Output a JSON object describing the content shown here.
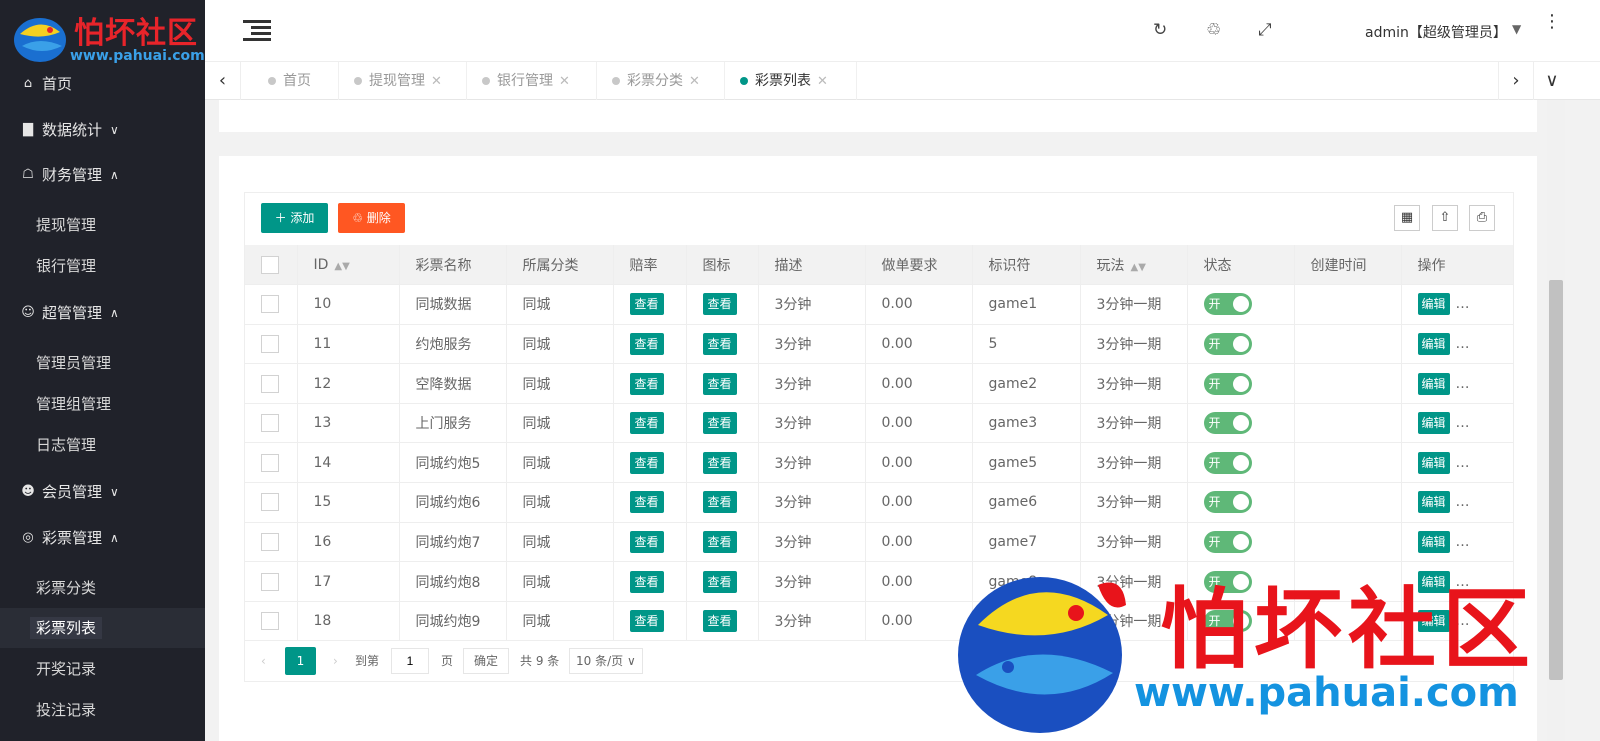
{
  "logo": {
    "text": "怕坏社区",
    "url": "www.pahuai.com"
  },
  "sidebar": {
    "home": "首页",
    "stats": "数据统计",
    "finance": "财务管理",
    "withdraw": "提现管理",
    "bank": "银行管理",
    "super": "超管管理",
    "admin_mgr": "管理员管理",
    "group_mgr": "管理组管理",
    "log_mgr": "日志管理",
    "member": "会员管理",
    "lottery": "彩票管理",
    "lottery_cat": "彩票分类",
    "lottery_list": "彩票列表",
    "draw_record": "开奖记录",
    "bet_record": "投注记录"
  },
  "header": {
    "user": "admin【超级管理员】"
  },
  "tabs": [
    {
      "label": "首页",
      "closable": false
    },
    {
      "label": "提现管理",
      "closable": true
    },
    {
      "label": "银行管理",
      "closable": true
    },
    {
      "label": "彩票分类",
      "closable": true
    },
    {
      "label": "彩票列表",
      "closable": true,
      "active": true
    }
  ],
  "toolbar": {
    "add": "添加",
    "delete": "删除"
  },
  "table": {
    "columns": [
      "ID",
      "彩票名称",
      "所属分类",
      "赔率",
      "图标",
      "描述",
      "做单要求",
      "标识符",
      "玩法",
      "状态",
      "创建时间",
      "操作"
    ],
    "view_label": "查看",
    "edit_label": "编辑",
    "switch_label": "开",
    "more": "…",
    "rows": [
      {
        "id": "10",
        "name": "同城数据",
        "cat": "同城",
        "desc": "3分钟",
        "req": "0.00",
        "code": "game1",
        "play": "3分钟一期"
      },
      {
        "id": "11",
        "name": "约炮服务",
        "cat": "同城",
        "desc": "3分钟",
        "req": "0.00",
        "code": "5",
        "play": "3分钟一期"
      },
      {
        "id": "12",
        "name": "空降数据",
        "cat": "同城",
        "desc": "3分钟",
        "req": "0.00",
        "code": "game2",
        "play": "3分钟一期"
      },
      {
        "id": "13",
        "name": "上门服务",
        "cat": "同城",
        "desc": "3分钟",
        "req": "0.00",
        "code": "game3",
        "play": "3分钟一期"
      },
      {
        "id": "14",
        "name": "同城约炮5",
        "cat": "同城",
        "desc": "3分钟",
        "req": "0.00",
        "code": "game5",
        "play": "3分钟一期"
      },
      {
        "id": "15",
        "name": "同城约炮6",
        "cat": "同城",
        "desc": "3分钟",
        "req": "0.00",
        "code": "game6",
        "play": "3分钟一期"
      },
      {
        "id": "16",
        "name": "同城约炮7",
        "cat": "同城",
        "desc": "3分钟",
        "req": "0.00",
        "code": "game7",
        "play": "3分钟一期"
      },
      {
        "id": "17",
        "name": "同城约炮8",
        "cat": "同城",
        "desc": "3分钟",
        "req": "0.00",
        "code": "game8",
        "play": "3分钟一期"
      },
      {
        "id": "18",
        "name": "同城约炮9",
        "cat": "同城",
        "desc": "3分钟",
        "req": "0.00",
        "code": "game9",
        "play": "3分钟一期"
      }
    ]
  },
  "pager": {
    "current": "1",
    "goto": "到第",
    "page_input": "1",
    "page_unit": "页",
    "confirm": "确定",
    "total": "共 9 条",
    "per_page": "10 条/页"
  },
  "watermark": {
    "text": "怕坏社区",
    "url": "www.pahuai.com"
  },
  "colors": {
    "primary": "#009688",
    "danger": "#ff5722",
    "sidebar": "#20222a",
    "switch_on": "#5fb878"
  }
}
